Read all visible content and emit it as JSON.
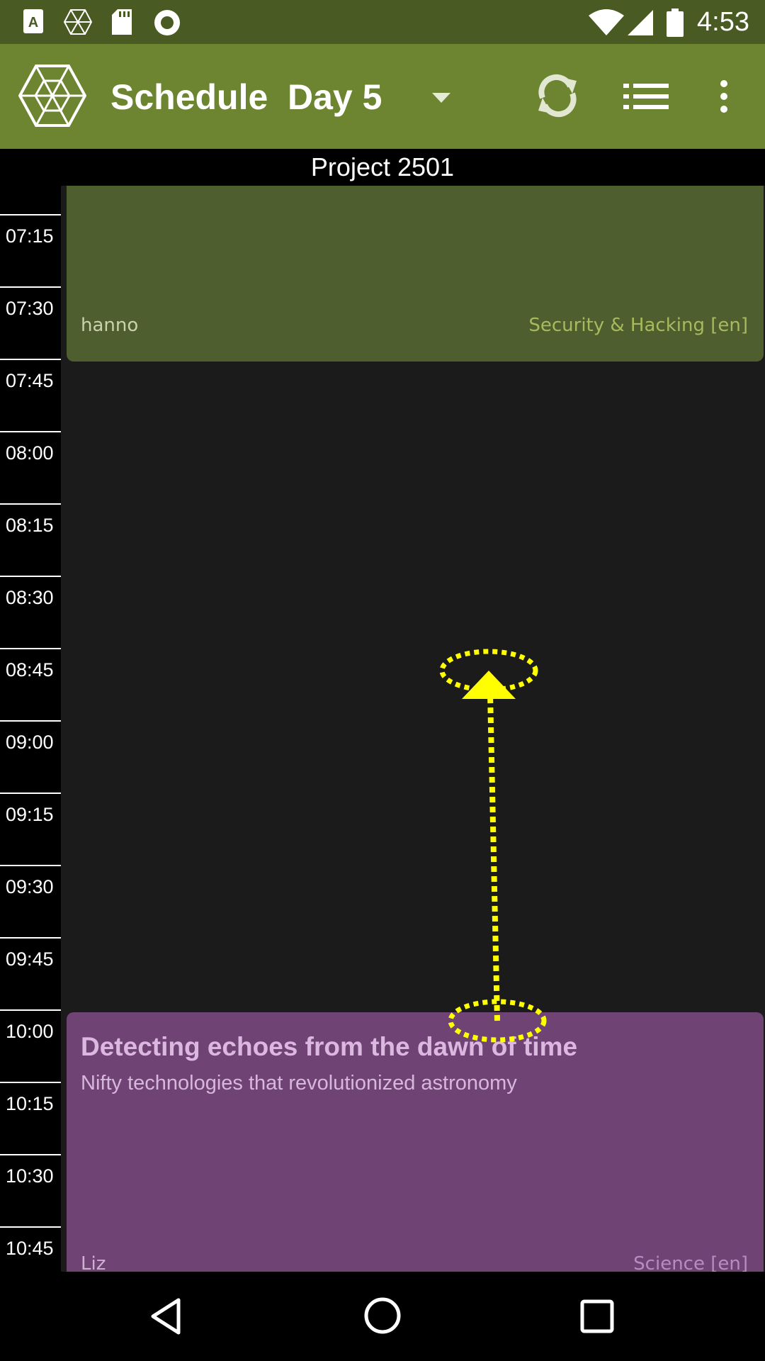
{
  "status_bar": {
    "time": "4:53",
    "left_icons": [
      "a-icon",
      "hexagon-icon",
      "sd-card-icon",
      "circle-record-icon"
    ],
    "right_icons": [
      "wifi-icon",
      "cell-signal-icon",
      "battery-icon"
    ]
  },
  "app_bar": {
    "title": "Schedule",
    "day": "Day 5",
    "icons": [
      "app-logo-icon",
      "dropdown-arrow-icon",
      "refresh-icon",
      "list-view-icon",
      "more-vert-icon"
    ],
    "color": "#6d8430"
  },
  "room": {
    "name": "Project 2501"
  },
  "timeline": {
    "slots": [
      "07:15",
      "07:30",
      "07:45",
      "08:00",
      "08:15",
      "08:30",
      "08:45",
      "09:00",
      "09:15",
      "09:30",
      "09:45",
      "10:00",
      "10:15",
      "10:30",
      "10:45"
    ]
  },
  "events": [
    {
      "title": "",
      "subtitle": "",
      "speaker": "hanno",
      "track": "Security & Hacking [en]",
      "color": "#4e5e2f"
    },
    {
      "title": "Detecting echoes from the dawn of time",
      "subtitle": "Nifty technologies that revolutionized astronomy",
      "speaker": "Liz",
      "track": "Science [en]",
      "color": "#6f4475"
    }
  ],
  "gesture_overlay": {
    "type": "swipe-up",
    "color": "#ffff00"
  },
  "nav_bar": {
    "icons": [
      "back-icon",
      "home-icon",
      "recents-icon"
    ]
  }
}
